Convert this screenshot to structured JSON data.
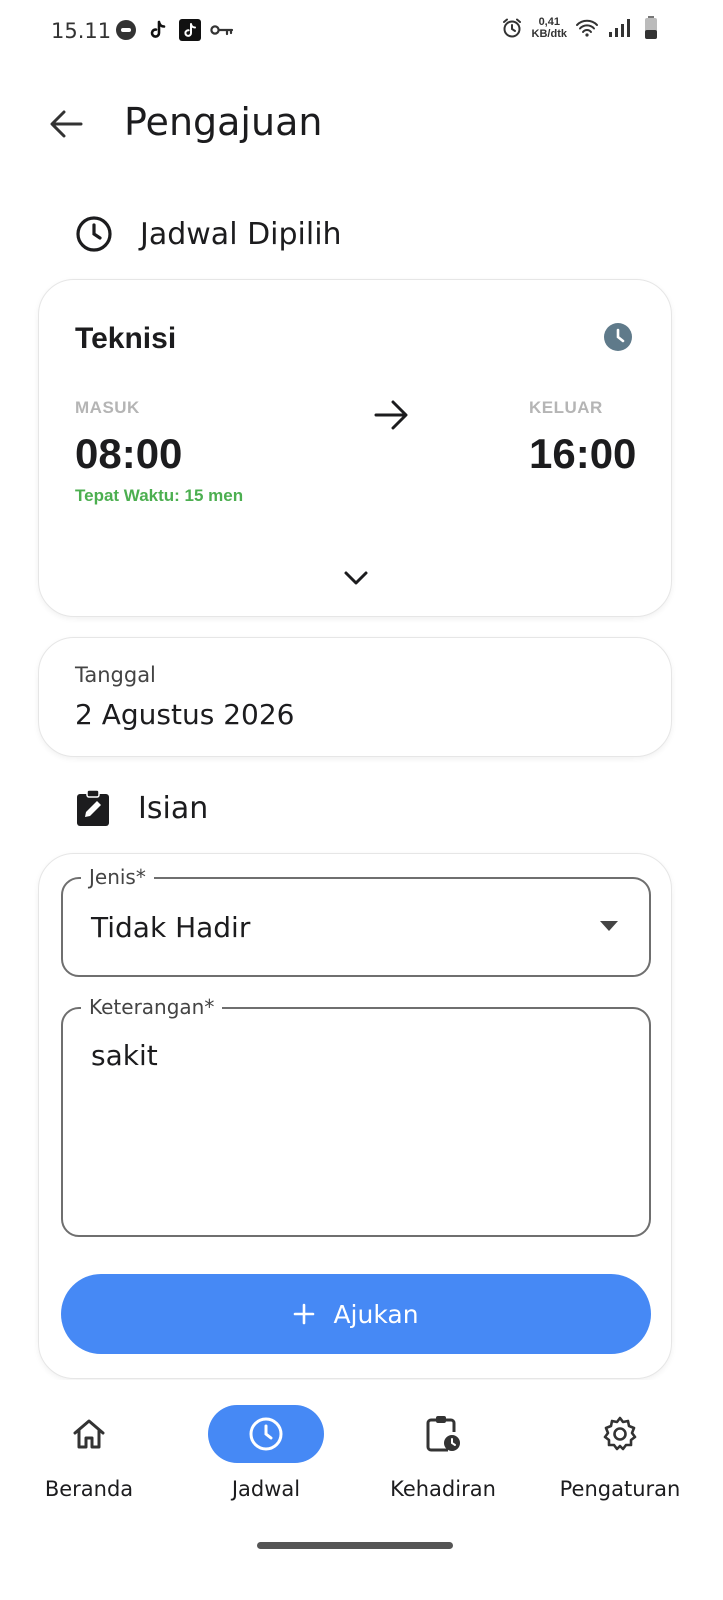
{
  "status_bar": {
    "time": "15.11",
    "speed_value": "0,41",
    "speed_unit": "KB/dtk"
  },
  "app_bar": {
    "title": "Pengajuan"
  },
  "schedule_section": {
    "title": "Jadwal Dipilih",
    "shift_name": "Teknisi",
    "in_label": "MASUK",
    "in_time": "08:00",
    "ontime_text": "Tepat Waktu: 15 men",
    "out_label": "KELUAR",
    "out_time": "16:00"
  },
  "date_card": {
    "label": "Tanggal",
    "value": "2 Agustus 2026"
  },
  "form_section": {
    "title": "Isian",
    "type_label": "Jenis*",
    "type_value": "Tidak Hadir",
    "note_label": "Keterangan*",
    "note_value": "sakit",
    "submit_label": "Ajukan"
  },
  "bottom_nav": {
    "items": [
      {
        "label": "Beranda",
        "icon": "home-icon",
        "active": false
      },
      {
        "label": "Jadwal",
        "icon": "clock-icon",
        "active": true
      },
      {
        "label": "Kehadiran",
        "icon": "clipboard-clock-icon",
        "active": false
      },
      {
        "label": "Pengaturan",
        "icon": "gear-icon",
        "active": false
      }
    ]
  },
  "colors": {
    "accent": "#4689f5",
    "ontime": "#4caf50",
    "muted_label": "#b5b5b5",
    "shift_icon": "#5f7a8a"
  }
}
